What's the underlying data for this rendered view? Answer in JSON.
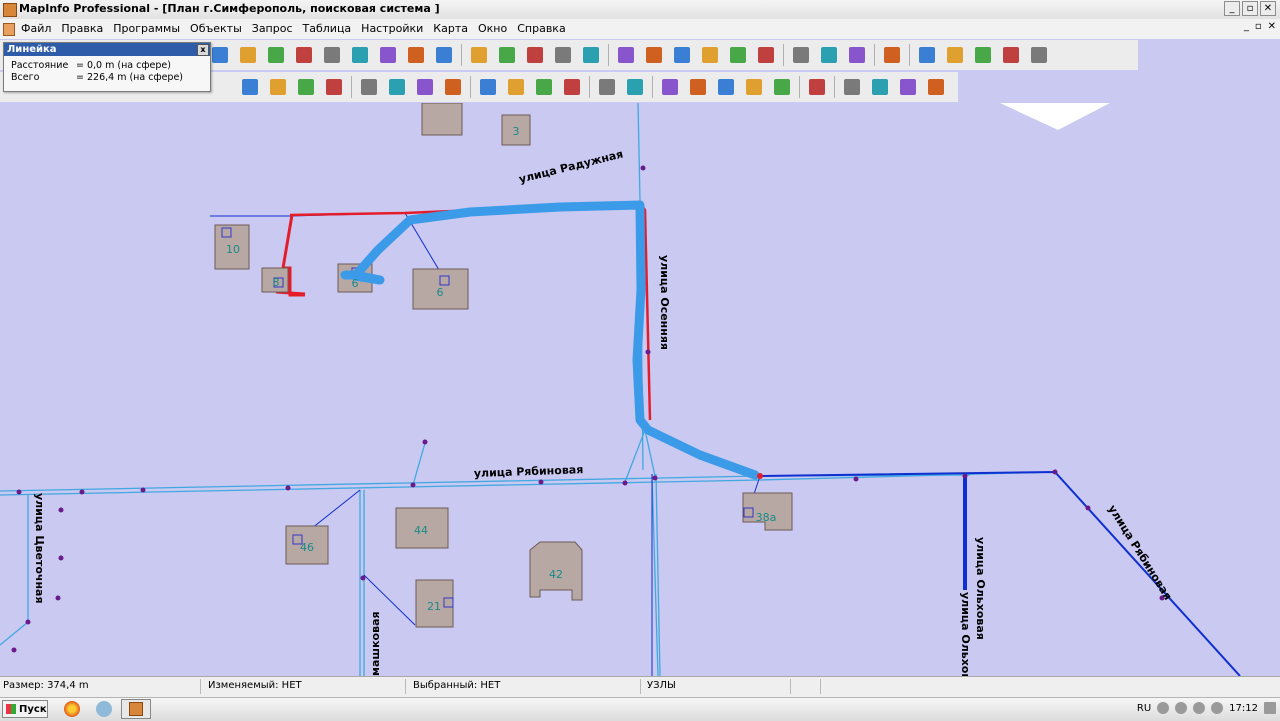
{
  "window": {
    "title": "MapInfo Professional - [План г.Симферополь, поисковая система ]",
    "buttons": [
      "_",
      "▫",
      "✕"
    ],
    "mdi_buttons": [
      "_",
      "▫",
      "✕"
    ]
  },
  "menu": [
    "Файл",
    "Правка",
    "Программы",
    "Объекты",
    "Запрос",
    "Таблица",
    "Настройки",
    "Карта",
    "Окно",
    "Справка"
  ],
  "ruler": {
    "title": "Линейка",
    "close": "x",
    "distance_label": "Расстояние",
    "distance_value": "= 0,0 m (на сфере)",
    "total_label": "Всего",
    "total_value": "= 226,4 m (на сфере)"
  },
  "map": {
    "streets": [
      "улица Радужная",
      "улица Осенняя",
      "улица Рябиновая",
      "улица Цветочная",
      "улица Ольховая",
      "улица Ольховая",
      "улица Рябиновая",
      "машковая"
    ],
    "buildings": [
      "3",
      "10",
      "8",
      "6",
      "6",
      "38а",
      "46",
      "44",
      "42",
      "21"
    ],
    "colors": {
      "background": "#c9c9f2",
      "route": "#3c9be8",
      "red_line": "#e41d2b",
      "blue_line": "#0f2fcf",
      "cyan_line": "#41a8e0",
      "building_fill": "#b7a8a3"
    }
  },
  "status": {
    "size": "Размер: 374,4 m",
    "modified": "Изменяемый: НЕТ",
    "selected": "Выбранный: НЕТ",
    "nodes": "УЗЛЫ"
  },
  "taskbar": {
    "start": "Пуск",
    "lang": "RU",
    "time": "17:12"
  },
  "toolbar_icons_row1": [
    "line-style-icon",
    "text-icon",
    "rectangle-icon",
    "polygon-icon",
    "reshape-icon",
    "symbol-icon",
    "draw-line-icon",
    "house-icon",
    "font-icon",
    "new-table-icon",
    "open-folder-icon",
    "open-workspace-icon",
    "grid-icon",
    "export-icon",
    "save-icon",
    "save-as-icon",
    "folder-icon",
    "layout-icon",
    "print-icon",
    "pdf-icon",
    "cut-icon",
    "copy-icon",
    "paste-icon",
    "undo-icon",
    "browser-icon",
    "map-window-icon",
    "graph-icon",
    "layout-window-icon",
    "redistrict-icon"
  ],
  "toolbar_icons_row2": [
    "zoom-in-icon",
    "zoom-out-icon",
    "change-view-icon",
    "pan-hand-icon",
    "info-icon",
    "label-icon",
    "drag-map-icon",
    "hotlink-icon",
    "layer-control-icon",
    "ruler-icon",
    "legend-icon",
    "statistics-icon",
    "select-icon",
    "radius-select-icon",
    "boundary-select-icon",
    "cosmetic-icon",
    "clip-icon",
    "tool-icon",
    "list-icon",
    "home-icon",
    "arrow-right-icon",
    "arrow-up-icon",
    "arrow-left-icon",
    "arrow-down-icon"
  ]
}
